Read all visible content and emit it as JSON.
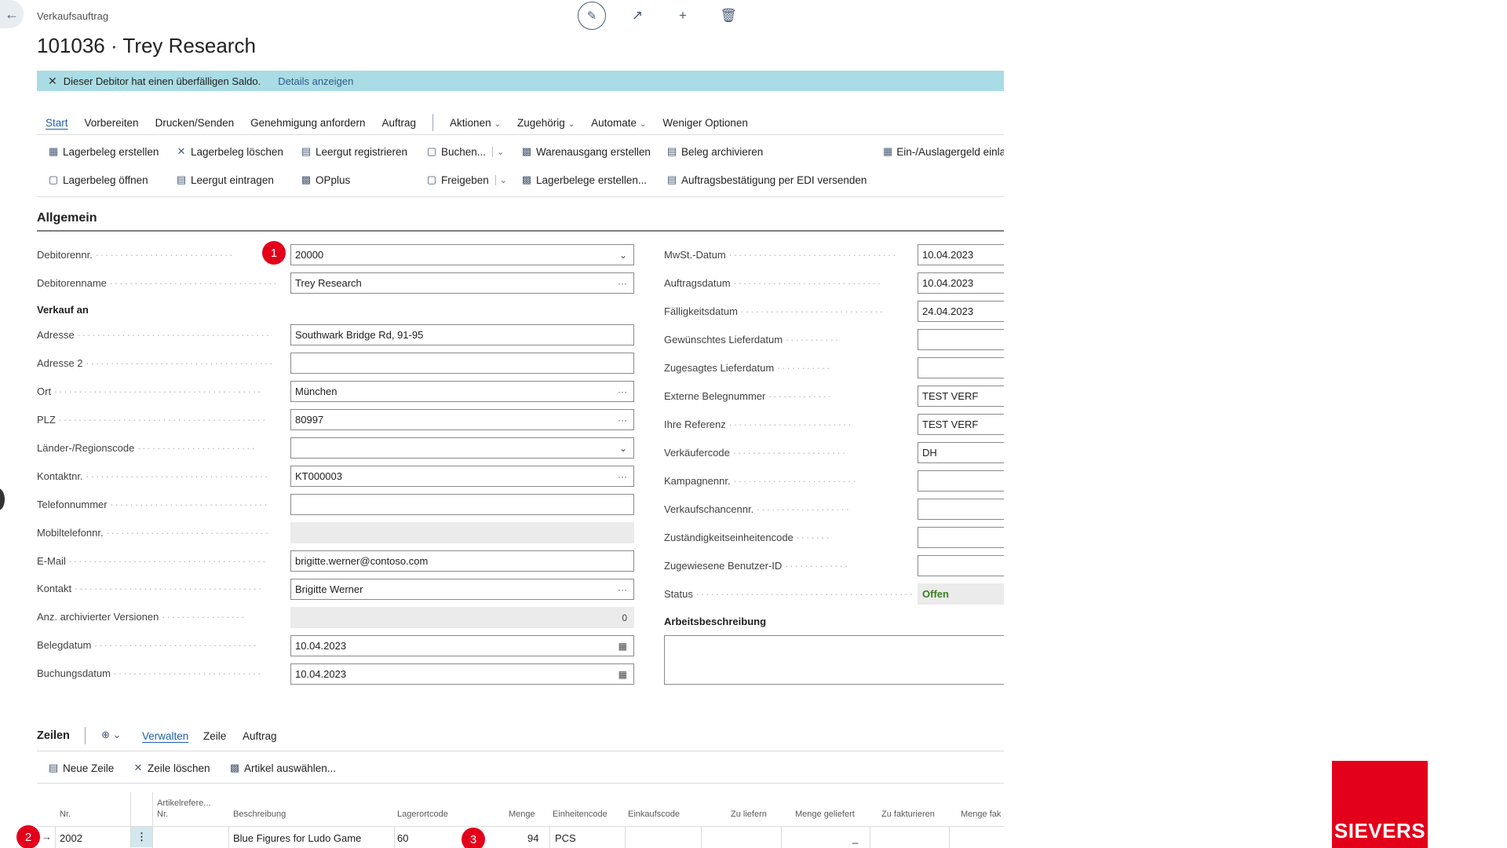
{
  "header": {
    "doc_type": "Verkaufsauftrag",
    "title": "101036 · Trey Research"
  },
  "notification": {
    "text": "Dieser Debitor hat einen überfälligen Saldo.",
    "link": "Details anzeigen"
  },
  "menu": {
    "start": "Start",
    "vorbereiten": "Vorbereiten",
    "drucken": "Drucken/Senden",
    "genehmigung": "Genehmigung anfordern",
    "auftrag": "Auftrag",
    "aktionen": "Aktionen",
    "zugehoerig": "Zugehörig",
    "automate": "Automate",
    "weniger": "Weniger Optionen"
  },
  "actions": {
    "lagerbeleg_erstellen": "Lagerbeleg erstellen",
    "lagerbeleg_loeschen": "Lagerbeleg löschen",
    "leergut_registrieren": "Leergut registrieren",
    "buchen": "Buchen...",
    "warenausgang": "Warenausgang erstellen",
    "beleg_archivieren": "Beleg archivieren",
    "ein_auslagergeld": "Ein-/Auslagergeld einla",
    "lagerbeleg_oeffnen": "Lagerbeleg öffnen",
    "leergut_eintragen": "Leergut eintragen",
    "opplus": "OPplus",
    "freigeben": "Freigeben",
    "lagerbelege_erstellen": "Lagerbelege erstellen...",
    "auftragsbestaetigung": "Auftragsbestätigung per EDI versenden"
  },
  "general": {
    "section_title": "Allgemein",
    "verkauf_an": "Verkauf an",
    "arbeitsbeschreibung": "Arbeitsbeschreibung",
    "left_fields": {
      "debitorennr": {
        "label": "Debitorennr.",
        "value": "20000"
      },
      "debitorenname": {
        "label": "Debitorenname",
        "value": "Trey Research"
      },
      "adresse": {
        "label": "Adresse",
        "value": "Southwark Bridge Rd, 91-95"
      },
      "adresse2": {
        "label": "Adresse 2",
        "value": ""
      },
      "ort": {
        "label": "Ort",
        "value": "München"
      },
      "plz": {
        "label": "PLZ",
        "value": "80997"
      },
      "land": {
        "label": "Länder-/Regionscode",
        "value": ""
      },
      "kontaktnr": {
        "label": "Kontaktnr.",
        "value": "KT000003"
      },
      "telefon": {
        "label": "Telefonnummer",
        "value": ""
      },
      "mobil": {
        "label": "Mobiltelefonnr.",
        "value": ""
      },
      "email": {
        "label": "E-Mail",
        "value": "brigitte.werner@contoso.com"
      },
      "kontakt": {
        "label": "Kontakt",
        "value": "Brigitte Werner"
      },
      "versionen": {
        "label": "Anz. archivierter Versionen",
        "value": "0"
      },
      "belegdatum": {
        "label": "Belegdatum",
        "value": "10.04.2023"
      },
      "buchungsdatum": {
        "label": "Buchungsdatum",
        "value": "10.04.2023"
      }
    },
    "right_fields": {
      "mwst_datum": {
        "label": "MwSt.-Datum",
        "value": "10.04.2023"
      },
      "auftragsdatum": {
        "label": "Auftragsdatum",
        "value": "10.04.2023"
      },
      "faelligkeit": {
        "label": "Fälligkeitsdatum",
        "value": "24.04.2023"
      },
      "gew_lieferdatum": {
        "label": "Gewünschtes Lieferdatum",
        "value": ""
      },
      "zug_lieferdatum": {
        "label": "Zugesagtes Lieferdatum",
        "value": ""
      },
      "ext_belegnr": {
        "label": "Externe Belegnummer",
        "value": "TEST VERF"
      },
      "referenz": {
        "label": "Ihre Referenz",
        "value": "TEST VERF"
      },
      "verkaeufer": {
        "label": "Verkäufercode",
        "value": "DH"
      },
      "kampagne": {
        "label": "Kampagnennr.",
        "value": ""
      },
      "verkaufschance": {
        "label": "Verkaufschancennr.",
        "value": ""
      },
      "zustaendigkeit": {
        "label": "Zuständigkeitseinheitencode",
        "value": ""
      },
      "benutzer": {
        "label": "Zugewiesene Benutzer-ID",
        "value": ""
      },
      "status": {
        "label": "Status",
        "value": "Offen"
      }
    }
  },
  "lines": {
    "title": "Zeilen",
    "tabs": {
      "verwalten": "Verwalten",
      "zeile": "Zeile",
      "auftrag": "Auftrag"
    },
    "actions": {
      "neue_zeile": "Neue Zeile",
      "zeile_loeschen": "Zeile löschen",
      "artikel_auswaehlen": "Artikel auswählen..."
    },
    "columns": {
      "nr": "Nr.",
      "artikelref1": "Artikelrefere...",
      "artikelref2": "Nr.",
      "beschreibung": "Beschreibung",
      "lagerort": "Lagerortcode",
      "menge": "Menge",
      "einheit": "Einheitencode",
      "einkaufscode": "Einkaufscode",
      "zu_liefern": "Zu liefern",
      "menge_geliefert": "Menge geliefert",
      "zu_fakturieren": "Zu fakturieren",
      "menge_fak": "Menge fak"
    },
    "row": {
      "nr": "2002",
      "beschreibung": "Blue Figures for Ludo Game",
      "lagerort": "60",
      "menge": "94",
      "einheit": "PCS",
      "menge_geliefert": "_"
    }
  },
  "badges": {
    "b1": "1",
    "b2": "2",
    "b3": "3"
  },
  "logo": "SIEVERS",
  "colors": {
    "accent": "#1d5fa8",
    "notification": "#a9dce4",
    "badge": "#e3001b",
    "status_open": "#3a7d1e"
  }
}
